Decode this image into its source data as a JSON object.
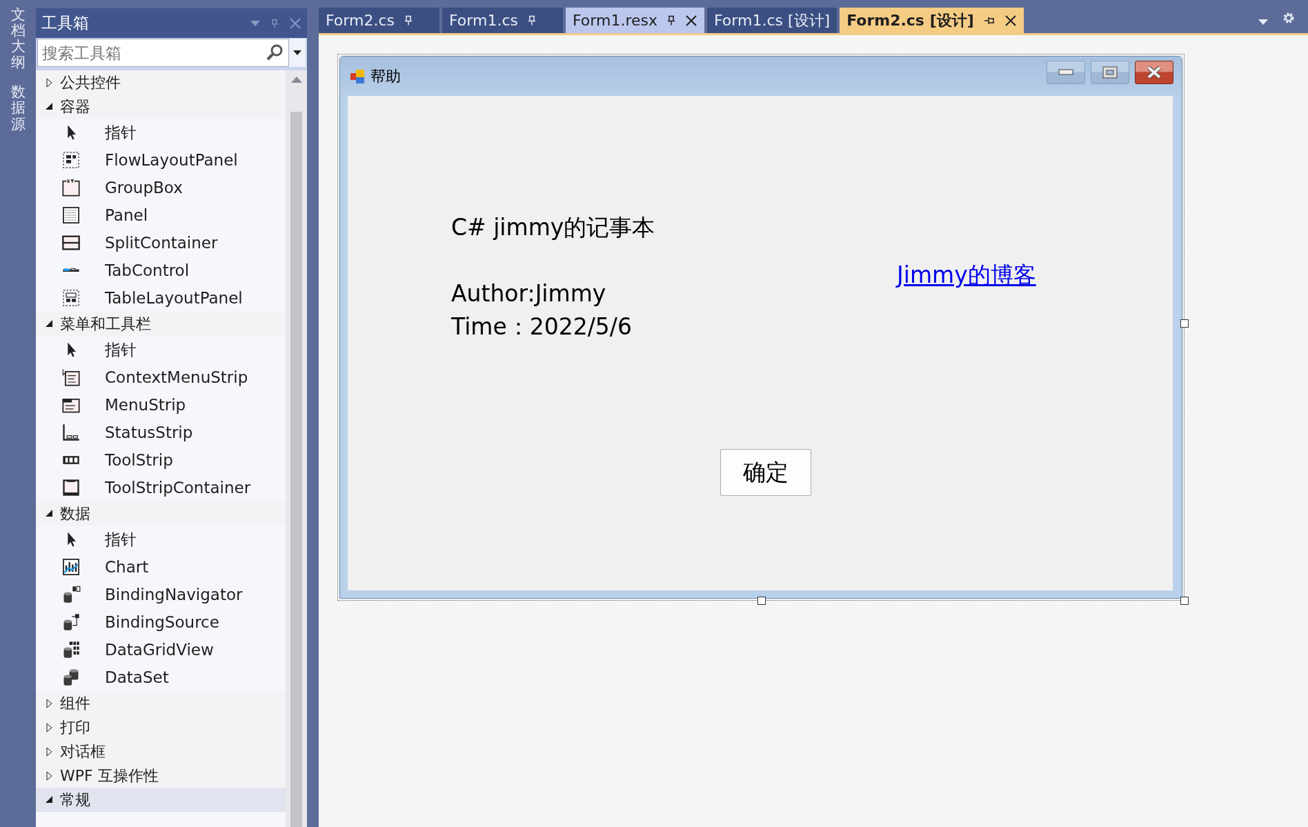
{
  "side_tabs": [
    {
      "label": "文档大纲"
    },
    {
      "label": "数据源"
    }
  ],
  "toolbox": {
    "title": "工具箱",
    "search": {
      "placeholder": "搜索工具箱"
    },
    "groups": [
      {
        "label": "公共控件",
        "expanded": false,
        "selected": false
      },
      {
        "label": "容器",
        "expanded": true,
        "selected": false,
        "children": [
          {
            "label": "指针",
            "kind": "pointer"
          },
          {
            "label": "FlowLayoutPanel",
            "kind": "flow"
          },
          {
            "label": "GroupBox",
            "kind": "groupbox"
          },
          {
            "label": "Panel",
            "kind": "panel"
          },
          {
            "label": "SplitContainer",
            "kind": "split"
          },
          {
            "label": "TabControl",
            "kind": "tab"
          },
          {
            "label": "TableLayoutPanel",
            "kind": "table"
          }
        ]
      },
      {
        "label": "菜单和工具栏",
        "expanded": true,
        "selected": false,
        "children": [
          {
            "label": "指针",
            "kind": "pointer"
          },
          {
            "label": "ContextMenuStrip",
            "kind": "contextmenu"
          },
          {
            "label": "MenuStrip",
            "kind": "menustrip"
          },
          {
            "label": "StatusStrip",
            "kind": "statusstrip"
          },
          {
            "label": "ToolStrip",
            "kind": "toolstrip"
          },
          {
            "label": "ToolStripContainer",
            "kind": "container"
          }
        ]
      },
      {
        "label": "数据",
        "expanded": true,
        "selected": false,
        "children": [
          {
            "label": "指针",
            "kind": "pointer"
          },
          {
            "label": "Chart",
            "kind": "chart"
          },
          {
            "label": "BindingNavigator",
            "kind": "navigator"
          },
          {
            "label": "BindingSource",
            "kind": "source"
          },
          {
            "label": "DataGridView",
            "kind": "grid"
          },
          {
            "label": "DataSet",
            "kind": "dataset"
          }
        ]
      },
      {
        "label": "组件",
        "expanded": false,
        "selected": false
      },
      {
        "label": "打印",
        "expanded": false,
        "selected": false
      },
      {
        "label": "对话框",
        "expanded": false,
        "selected": false
      },
      {
        "label": "WPF 互操作性",
        "expanded": false,
        "selected": false
      },
      {
        "label": "常规",
        "expanded": true,
        "selected": true
      }
    ]
  },
  "tabs": [
    {
      "label": "Form2.cs",
      "selected": false,
      "hover": false,
      "pin": true,
      "pinned": true,
      "closable": false
    },
    {
      "label": "Form1.cs",
      "selected": false,
      "hover": false,
      "pin": true,
      "pinned": true,
      "closable": false
    },
    {
      "label": "Form1.resx",
      "selected": false,
      "hover": true,
      "pin": true,
      "pinned": true,
      "closable": true
    },
    {
      "label": "Form1.cs [设计]",
      "selected": false,
      "hover": false,
      "pin": false,
      "closable": false
    },
    {
      "label": "Form2.cs [设计]",
      "selected": true,
      "hover": false,
      "pin": true,
      "pinned": false,
      "closable": true
    }
  ],
  "designer": {
    "form": {
      "title": "帮助",
      "labels": [
        "C# jimmy的记事本",
        "Author:Jimmy",
        "Time：2022/5/6"
      ],
      "link": "Jimmy的博客",
      "button": "确定"
    }
  }
}
